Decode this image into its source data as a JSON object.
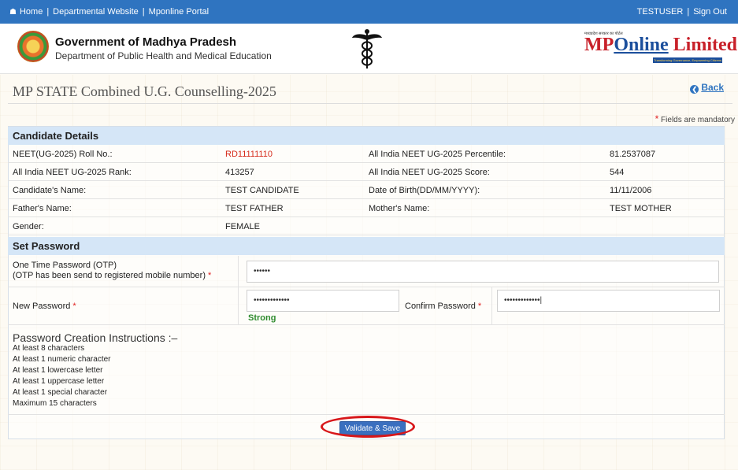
{
  "topbar": {
    "home": "Home",
    "departmental_website": "Departmental Website",
    "mponline_portal": "Mponline Portal",
    "separator": "|",
    "user": "TESTUSER",
    "sign_out": "Sign Out"
  },
  "header": {
    "gov_title": "Government of Madhya Pradesh",
    "gov_subtitle": "Department of Public Health and Medical Education",
    "mp_tagline": "मध्यप्रदेश सरकार का पोर्टल",
    "mp_word_mp": "MP",
    "mp_word_online": "Online",
    "mp_word_limited": " Limited",
    "mp_strip": "Transforming Governance, Empowering Citizens"
  },
  "page": {
    "title": "MP STATE Combined U.G. Counselling-2025",
    "back_label": "Back",
    "mandatory_star": "*",
    "mandatory_note": " Fields are mandatory"
  },
  "candidate": {
    "heading": "Candidate Details",
    "rows": [
      {
        "l1": "NEET(UG-2025) Roll No.:",
        "v1": "RD11111110",
        "l2": "All India NEET UG-2025 Percentile:",
        "v2": "81.2537087"
      },
      {
        "l1": "All India NEET UG-2025 Rank:",
        "v1": "413257",
        "l2": "All India NEET UG-2025 Score:",
        "v2": "544"
      },
      {
        "l1": "Candidate's Name:",
        "v1": "TEST CANDIDATE",
        "l2": "Date of Birth(DD/MM/YYYY):",
        "v2": "11/11/2006"
      },
      {
        "l1": "Father's Name:",
        "v1": "TEST FATHER",
        "l2": "Mother's Name:",
        "v2": "TEST MOTHER"
      },
      {
        "l1": "Gender:",
        "v1": "FEMALE",
        "l2": "",
        "v2": ""
      }
    ]
  },
  "password": {
    "heading": "Set Password",
    "otp_label": "One Time Password (OTP)",
    "otp_note": "(OTP has been send to registered mobile number)",
    "req_star": "*",
    "otp_value": "••••••",
    "new_label": "New Password",
    "new_value": "•••••••••••••",
    "strength": "Strong",
    "confirm_label": "Confirm Password",
    "confirm_value": "•••••••••••••|"
  },
  "instructions": {
    "title": "Password Creation Instructions :–",
    "items": [
      "At least 8 characters",
      "At least 1 numeric character",
      "At least 1 lowercase letter",
      "At least 1 uppercase letter",
      "At least 1 special character",
      "Maximum 15 characters"
    ]
  },
  "actions": {
    "validate_save": "Validate & Save"
  },
  "colors": {
    "topbar": "#2f74c0",
    "section_head": "#d5e6f7",
    "roll_no": "#d52a1a",
    "strong": "#2e8b2e",
    "highlight": "#d8171a"
  }
}
